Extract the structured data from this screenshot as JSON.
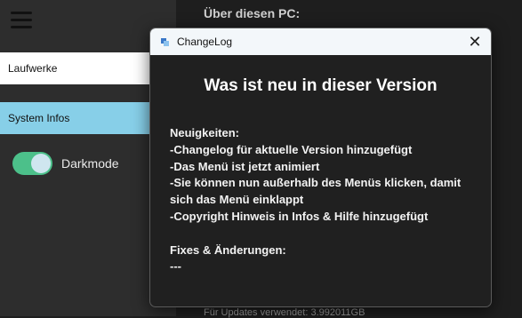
{
  "sidebar": {
    "items": [
      {
        "label": "Laufwerke"
      },
      {
        "label": "System Infos"
      }
    ],
    "darkmode_label": "Darkmode"
  },
  "main": {
    "heading": "Über diesen PC:",
    "footer_text": "Für Updates verwendet: 3.992011GB"
  },
  "dialog": {
    "title": "ChangeLog",
    "heading": "Was ist neu in dieser Version",
    "news_header": "Neuigkeiten:",
    "news": [
      "-Changelog für aktuelle Version hinzugefügt",
      "-Das Menü ist jetzt animiert",
      "-Sie können nun außerhalb des Menüs klicken, damit sich das Menü einklappt",
      "-Copyright Hinweis in Infos & Hilfe hinzugefügt"
    ],
    "fixes_header": "Fixes & Änderungen:",
    "fixes": [
      "---"
    ]
  },
  "colors": {
    "accent": "#87cfe8",
    "toggle_on": "#4cc08a"
  }
}
